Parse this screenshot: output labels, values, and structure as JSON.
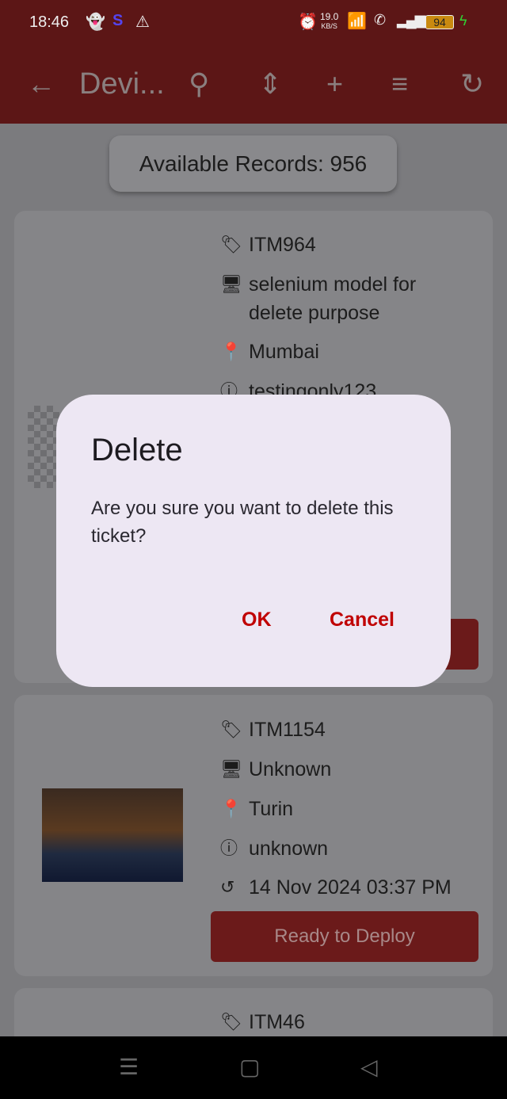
{
  "status_bar": {
    "time": "18:46",
    "net_speed": "19.0",
    "net_unit": "KB/S",
    "battery": "94"
  },
  "app_bar": {
    "title": "Devi...",
    "icons": [
      "back-arrow-icon",
      "search-icon",
      "expand-vertical-icon",
      "add-icon",
      "sort-icon",
      "refresh-icon"
    ]
  },
  "records_label": "Available Records: 956",
  "cards": [
    {
      "id": "ITM964",
      "model": "selenium model for delete purpose",
      "location": "Mumbai",
      "info": "testingonly123"
    },
    {
      "id": "ITM1154",
      "model": "Unknown",
      "location": "Turin",
      "info": "unknown",
      "date": "14 Nov 2024 03:37 PM",
      "button": "Ready to Deploy"
    },
    {
      "id": "ITM46"
    }
  ],
  "dialog": {
    "title": "Delete",
    "message": "Are you sure you want to delete this ticket?",
    "ok": "OK",
    "cancel": "Cancel"
  },
  "colors": {
    "app_bar": "#5c1616",
    "accent": "#c00000",
    "dialog_bg": "#ede7f3"
  }
}
